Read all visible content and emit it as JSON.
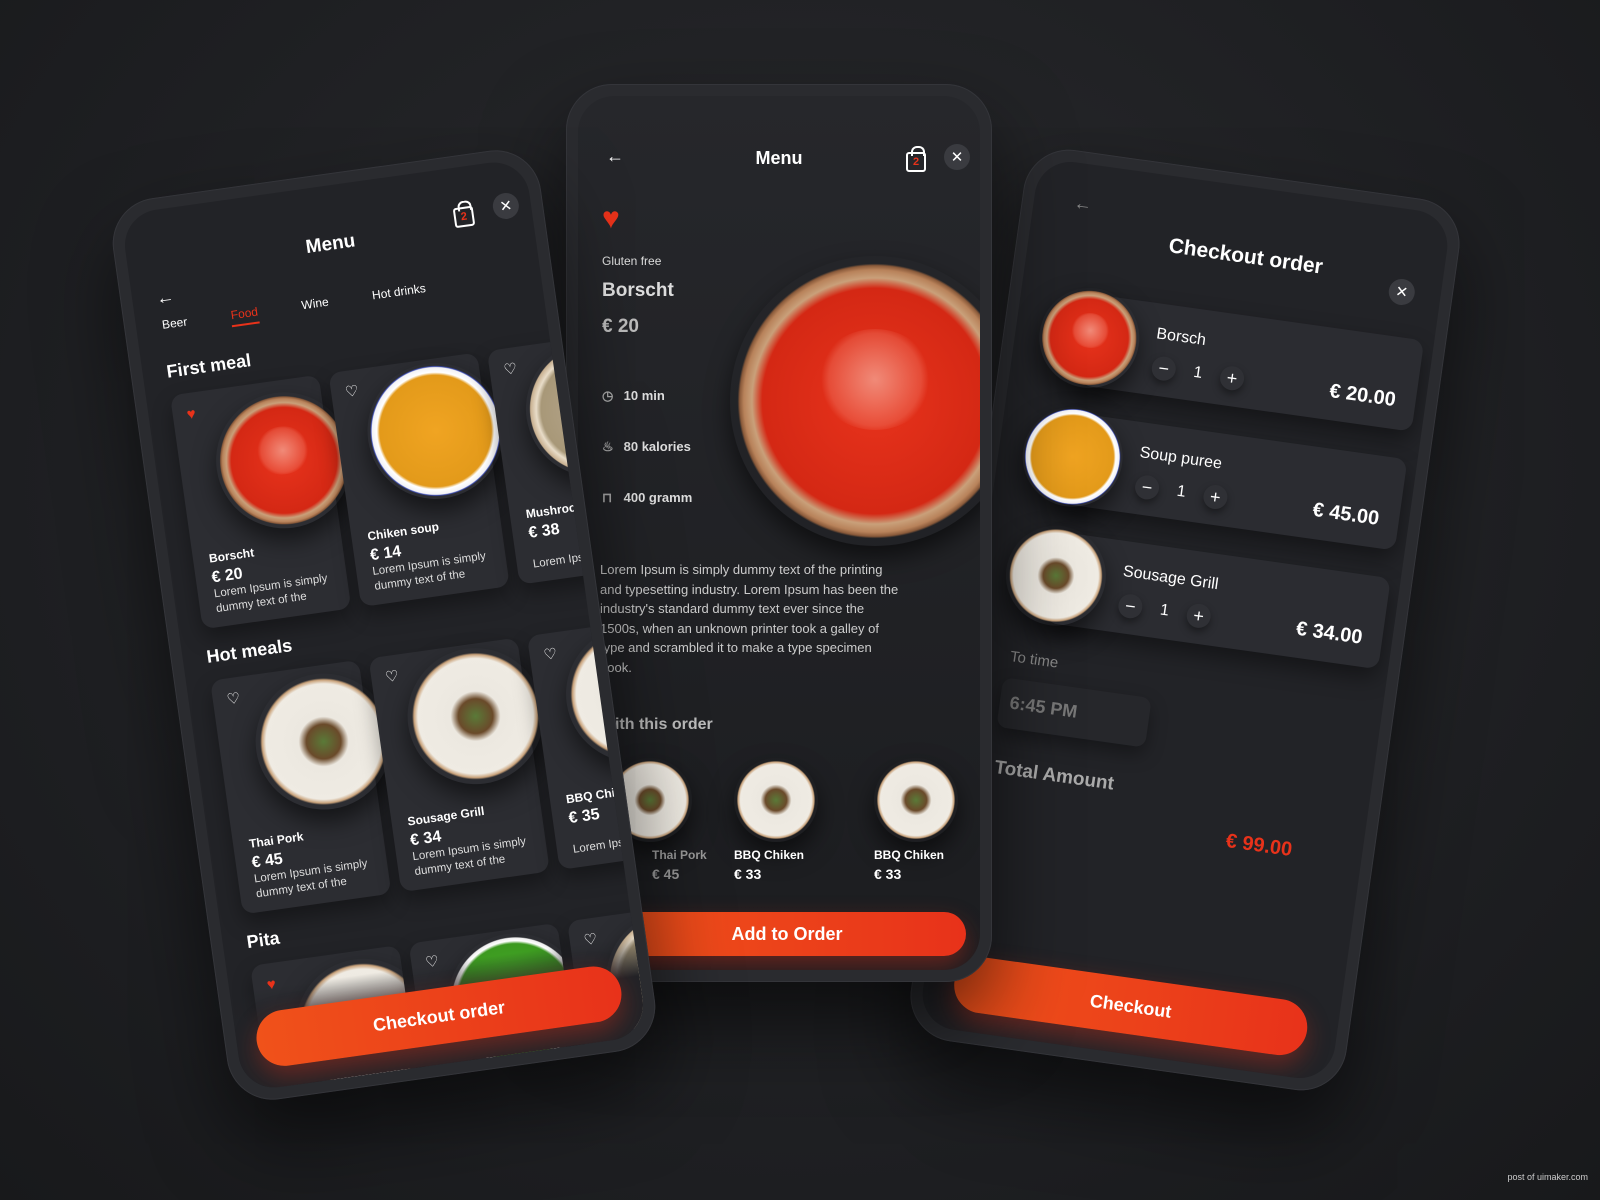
{
  "colors": {
    "accent": "#e8321a",
    "background": "#1e1f22",
    "card": "#2c2d32"
  },
  "left": {
    "title": "Menu",
    "cart_count": "2",
    "tabs": [
      {
        "label": "Beer"
      },
      {
        "label": "Food",
        "active": true
      },
      {
        "label": "Wine"
      },
      {
        "label": "Hot drinks"
      }
    ],
    "sections": [
      {
        "title": "First meal",
        "items": [
          {
            "name": "Borscht",
            "price": "€ 20",
            "desc": "Lorem Ipsum is simply dummy text of the",
            "favorite": true
          },
          {
            "name": "Chiken soup",
            "price": "€ 14",
            "desc": "Lorem Ipsum is simply dummy text of the",
            "favorite": false
          },
          {
            "name": "Mushroom",
            "price": "€ 38",
            "desc": "Lorem Ipsu dummy te",
            "favorite": false
          }
        ]
      },
      {
        "title": "Hot meals",
        "items": [
          {
            "name": "Thai Pork",
            "price": "€ 45",
            "desc": "Lorem Ipsum is simply dummy text of the",
            "favorite": false
          },
          {
            "name": "Sousage Grill",
            "price": "€ 34",
            "desc": "Lorem Ipsum is simply dummy text of the",
            "favorite": false
          },
          {
            "name": "BBQ Chike",
            "price": "€ 35",
            "desc": "Lorem Ipsu dummy te",
            "favorite": false
          }
        ]
      },
      {
        "title": "Pita",
        "items": [
          {
            "favorite": true
          },
          {
            "favorite": false
          },
          {
            "favorite": false
          }
        ]
      }
    ],
    "checkout_label": "Checkout order"
  },
  "middle": {
    "title": "Menu",
    "cart_count": "2",
    "favorite": true,
    "tag": "Gluten free",
    "name": "Borscht",
    "price": "€ 20",
    "meta": [
      {
        "icon": "clock-icon",
        "text": "10 min"
      },
      {
        "icon": "flame-icon",
        "text": "80 kalories"
      },
      {
        "icon": "weight-icon",
        "text": "400 gramm"
      }
    ],
    "description": "Lorem Ipsum is simply dummy text of the printing and typesetting industry. Lorem Ipsum has been the industry's standard dummy text ever since the 1500s, when an unknown printer took a galley of type and scrambled it to make a type specimen book.",
    "with_title": "With this order",
    "with_items": [
      {
        "name": "Thai Pork",
        "price": "€ 45"
      },
      {
        "name": "BBQ Chiken",
        "price": "€ 33"
      },
      {
        "name": "BBQ Chiken",
        "price": "€ 33"
      }
    ],
    "add_label": "Add to Order"
  },
  "right": {
    "title": "Checkout order",
    "items": [
      {
        "name": "Borsch",
        "qty": "1",
        "price": "€ 20.00"
      },
      {
        "name": "Soup puree",
        "qty": "1",
        "price": "€ 45.00"
      },
      {
        "name": "Sousage Grill",
        "qty": "1",
        "price": "€ 34.00"
      }
    ],
    "time_label": "To time",
    "time_value": "6:45 PM",
    "total_label": "Total Amount",
    "total_value": "€ 99.00",
    "checkout_label": "Checkout"
  },
  "watermark": "post of uimaker.com"
}
